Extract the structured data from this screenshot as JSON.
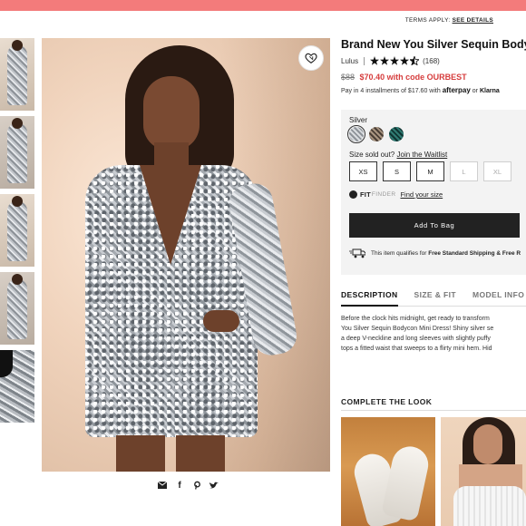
{
  "header": {
    "terms_prefix": "TERMS APPLY:",
    "terms_link": "SEE DETAILS"
  },
  "product": {
    "title": "Brand New You Silver Sequin Bodycon",
    "brand": "Lulus",
    "rating": 4.5,
    "review_count": "(168)",
    "old_price": "$88",
    "new_price": "$70.40 with code OURBEST",
    "installments_text": "Pay in 4 installments of $17.60 with",
    "afterpay": "afterpay",
    "or": "or",
    "klarna": "Klarna"
  },
  "options": {
    "color_label": "Silver",
    "swatch_colors": [
      "#b8bcc0",
      "#7a6e64",
      "#1f5a55"
    ],
    "sold_out_text": "Size sold out?",
    "waitlist_link": "Join the Waitlist",
    "sizes": [
      {
        "label": "XS",
        "available": true
      },
      {
        "label": "S",
        "available": true
      },
      {
        "label": "M",
        "available": true
      },
      {
        "label": "L",
        "available": false
      },
      {
        "label": "XL",
        "available": false
      }
    ],
    "fit_brand": "FIT",
    "fit_finder": "FINDER",
    "fit_link": "Find your size",
    "add_to_bag": "Add To Bag",
    "shipping_prefix": "This item qualifies for",
    "shipping_bold": "Free Standard Shipping & Free R"
  },
  "tabs": [
    "DESCRIPTION",
    "SIZE & FIT",
    "MODEL INFO"
  ],
  "description_lines": [
    "Before the clock hits midnight, get ready to transform",
    "You Silver Sequin Bodycon Mini Dress! Shiny silver se",
    "a deep V-neckline and long sleeves with slightly puffy",
    "tops a fitted waist that sweeps to a flirty mini hem. Hid"
  ],
  "complete_the_look": {
    "heading": "COMPLETE THE LOOK"
  },
  "colors": {
    "promo": "#f37b7b",
    "sale_price": "#d63d3d",
    "button": "#222222",
    "panel": "#f3f3f3"
  }
}
